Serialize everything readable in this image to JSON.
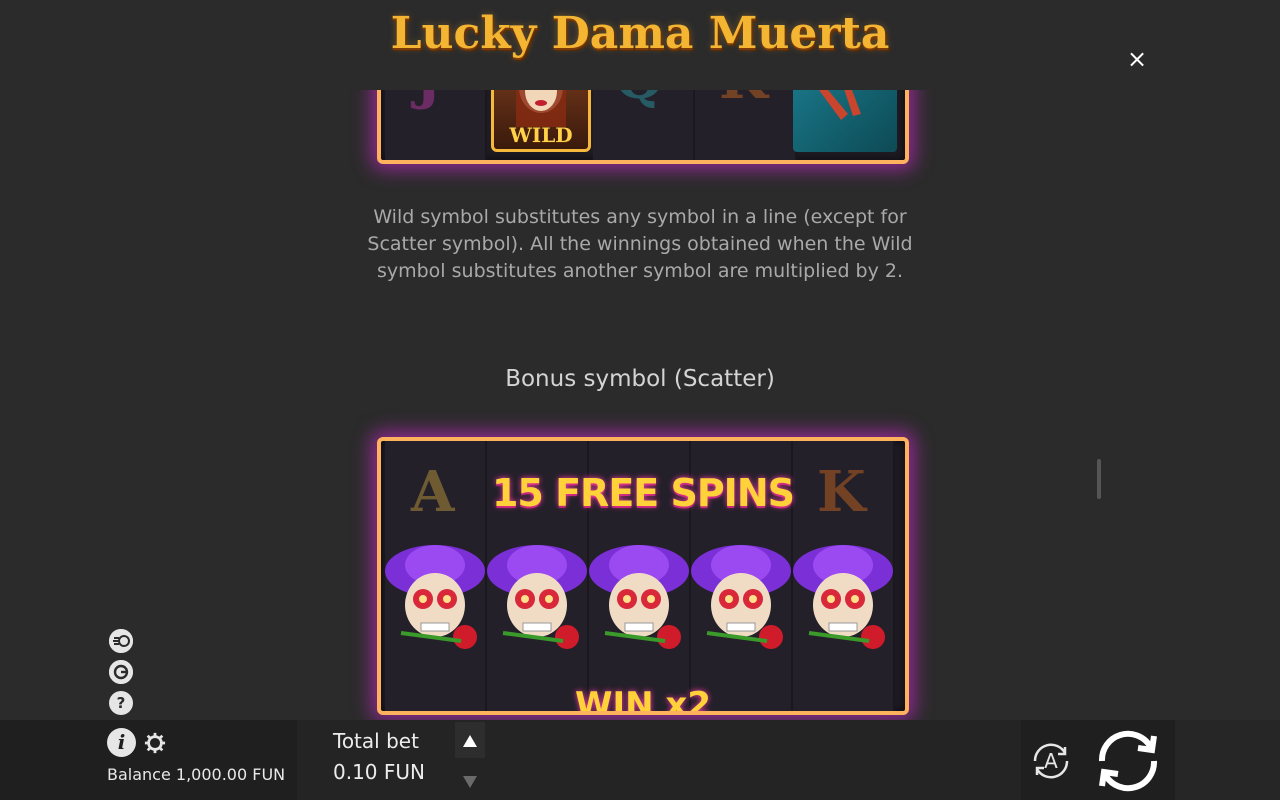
{
  "header": {
    "title": "Lucky Dama Muerta",
    "close_label": "×"
  },
  "wild_section": {
    "wild_tile_label": "WILD",
    "description": "Wild symbol substitutes any symbol in a line (except for Scatter symbol). All the winnings obtained when the Wild symbol substitutes another symbol are multiplied by 2."
  },
  "scatter_section": {
    "title": "Bonus symbol (Scatter)",
    "banner": "15 FREE SPINS",
    "win_text": "WIN x2"
  },
  "side_icons": {
    "turbo": "turbo-icon",
    "autoplay": "history-icon",
    "help": "?"
  },
  "bottom_bar": {
    "info_label": "i",
    "balance": "Balance 1,000.00 FUN",
    "bet_label": "Total bet",
    "bet_value": "0.10 FUN",
    "auto_label": "A"
  },
  "colors": {
    "background": "#2b2b2b",
    "accent_gold": "#f4b532",
    "glow_magenta": "#dc28dc",
    "frame_orange": "#ffb25e"
  }
}
